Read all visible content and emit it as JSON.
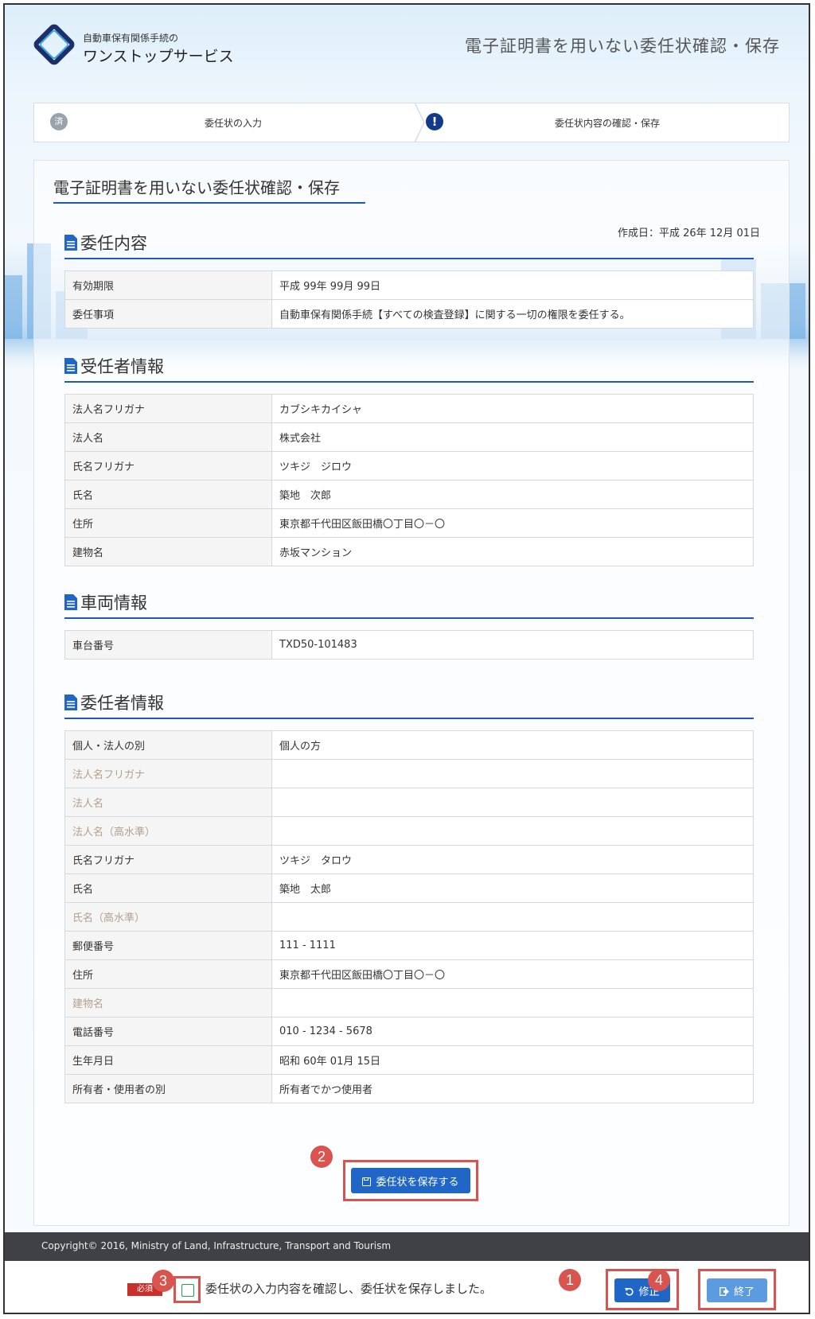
{
  "header": {
    "brand_small": "自動車保有関係手続の",
    "brand_big": "ワンストップサービス",
    "page_title": "電子証明書を用いない委任状確認・保存"
  },
  "steps": [
    {
      "icon": "済",
      "label": "委任状の入力"
    },
    {
      "icon": "!",
      "label": "委任状内容の確認・保存"
    }
  ],
  "panel": {
    "title": "電子証明書を用いない委任状確認・保存",
    "created": "作成日：平成 26年 12月 01日"
  },
  "sections": {
    "delegation": {
      "title": "委任内容",
      "rows": [
        {
          "key": "有効期限",
          "value": "平成 99年 99月 99日"
        },
        {
          "key": "委任事項",
          "value": "自動車保有関係手続【すべての検査登録】に関する一切の権限を委任する。"
        }
      ]
    },
    "agent": {
      "title": "受任者情報",
      "rows": [
        {
          "key": "法人名フリガナ",
          "value": "カブシキカイシャ"
        },
        {
          "key": "法人名",
          "value": "株式会社"
        },
        {
          "key": "氏名フリガナ",
          "value": "ツキジ　ジロウ"
        },
        {
          "key": "氏名",
          "value": "築地　次郎"
        },
        {
          "key": "住所",
          "value": "東京都千代田区飯田橋〇丁目〇－〇"
        },
        {
          "key": "建物名",
          "value": "赤坂マンション"
        }
      ]
    },
    "vehicle": {
      "title": "車両情報",
      "rows": [
        {
          "key": "車台番号",
          "value": "TXD50-101483"
        }
      ]
    },
    "principal": {
      "title": "委任者情報",
      "rows": [
        {
          "key": "個人・法人の別",
          "value": "個人の方"
        },
        {
          "key": "法人名フリガナ",
          "value": ""
        },
        {
          "key": "法人名",
          "value": ""
        },
        {
          "key": "法人名（高水準）",
          "value": ""
        },
        {
          "key": "氏名フリガナ",
          "value": "ツキジ　タロウ"
        },
        {
          "key": "氏名",
          "value": "築地　太郎"
        },
        {
          "key": "氏名（高水準）",
          "value": ""
        },
        {
          "key": "郵便番号",
          "value": "111 - 1111"
        },
        {
          "key": "住所",
          "value": "東京都千代田区飯田橋〇丁目〇－〇"
        },
        {
          "key": "建物名",
          "value": ""
        },
        {
          "key": "電話番号",
          "value": "010 - 1234 - 5678"
        },
        {
          "key": "生年月日",
          "value": "昭和 60年 01月 15日"
        },
        {
          "key": "所有者・使用者の別",
          "value": "所有者でかつ使用者"
        }
      ]
    }
  },
  "actions": {
    "save_label": "委任状を保存する",
    "fix_label": "修正",
    "end_label": "終了"
  },
  "footer": {
    "copyright": "Copyright© 2016, Ministry of Land, Infrastructure, Transport and Tourism",
    "required_badge": "必須",
    "confirm_label": "委任状の入力内容を確認し、委任状を保存しました。"
  },
  "badges": [
    "1",
    "2",
    "3",
    "4"
  ],
  "colors": {
    "accent": "#1e5ab4",
    "button": "#1f66c7",
    "highlight": "#d9534f",
    "footer": "#3f4144"
  }
}
